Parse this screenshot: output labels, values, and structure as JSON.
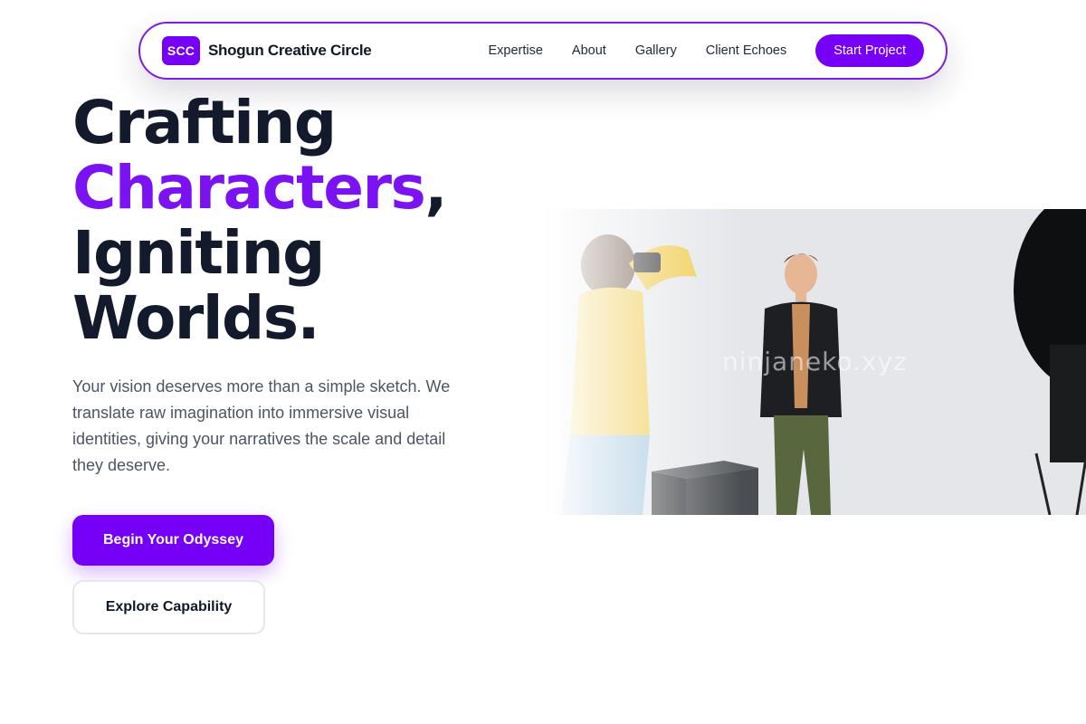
{
  "nav": {
    "logo_badge": "SCC",
    "brand_name": "Shogun Creative Circle",
    "links": [
      {
        "label": "Expertise"
      },
      {
        "label": "About"
      },
      {
        "label": "Gallery"
      },
      {
        "label": "Client Echoes"
      }
    ],
    "cta_label": "Start Project"
  },
  "hero": {
    "headline": {
      "line1": "Crafting",
      "line2_accent": "Characters",
      "line2_rest": ",",
      "line3": "Igniting",
      "line4": "Worlds."
    },
    "subtext": "Your vision deserves more than a simple sketch. We translate raw imagination into immersive visual identities, giving your narratives the scale and detail they deserve.",
    "primary_button": "Begin Your Odyssey",
    "secondary_button": "Explore Capability"
  },
  "image": {
    "watermark": "ninjaneko.xyz"
  },
  "colors": {
    "accent": "#7600f5",
    "heading": "#131a2c",
    "body_text": "#4b5563"
  }
}
